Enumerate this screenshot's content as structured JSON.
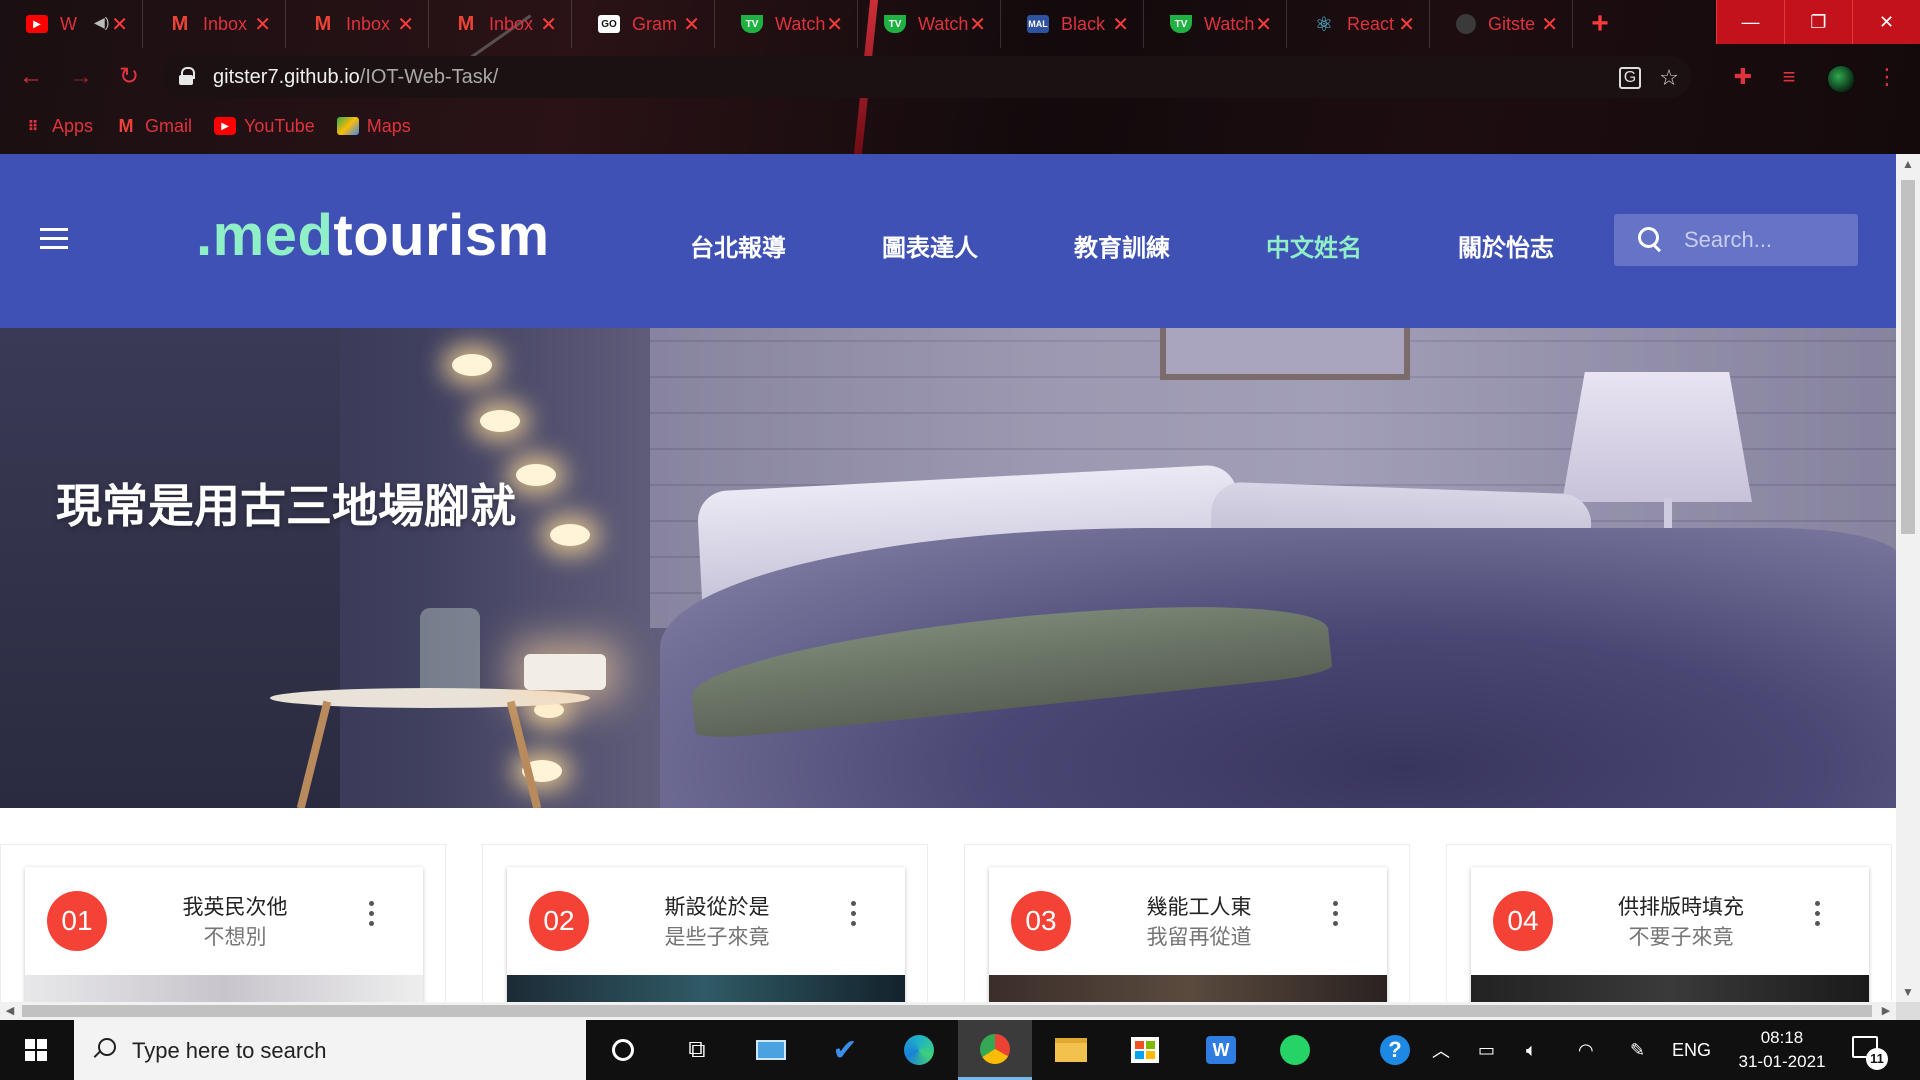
{
  "browser": {
    "tabs": [
      {
        "label": "W",
        "icon": "youtube-icon",
        "color": "#ff0000"
      },
      {
        "label": "Inbox",
        "icon": "gmail-icon",
        "color": "#ea4335"
      },
      {
        "label": "Inbox",
        "icon": "gmail-icon",
        "color": "#ea4335"
      },
      {
        "label": "Inbox",
        "icon": "gmail-icon",
        "color": "#ea4335"
      },
      {
        "label": "Gram",
        "icon": "grammarly-icon",
        "color": "#ffffff"
      },
      {
        "label": "Watch",
        "icon": "tv-icon",
        "color": "#1fb141"
      },
      {
        "label": "Watch",
        "icon": "tv-icon",
        "color": "#1fb141"
      },
      {
        "label": "Black",
        "icon": "mal-icon",
        "color": "#2e51a2"
      },
      {
        "label": "Watch",
        "icon": "tv-icon",
        "color": "#1fb141"
      },
      {
        "label": "React",
        "icon": "react-icon",
        "color": "#61dafb"
      },
      {
        "label": "Gitste",
        "icon": "github-icon",
        "color": "#3a3a3a"
      }
    ],
    "url_host": "gitster7.github.io",
    "url_path": "/IOT-Web-Task/",
    "bookmarks": [
      {
        "label": "Apps",
        "icon": "apps-grid-icon"
      },
      {
        "label": "Gmail",
        "icon": "gmail-icon"
      },
      {
        "label": "YouTube",
        "icon": "youtube-icon"
      },
      {
        "label": "Maps",
        "icon": "maps-icon"
      }
    ],
    "accent_color": "#e0323d"
  },
  "site": {
    "brand_accent": ".med",
    "brand_rest": "tourism",
    "nav": [
      {
        "label": "台北報導",
        "active": false
      },
      {
        "label": "圖表達人",
        "active": false
      },
      {
        "label": "教育訓練",
        "active": false
      },
      {
        "label": "中文姓名",
        "active": true
      },
      {
        "label": "關於怡志",
        "active": false
      }
    ],
    "search_placeholder": "Search...",
    "hero_title": "現常是用古三地場腳就",
    "primary_color": "#3f51b5",
    "active_color": "#8ff0c8",
    "cards": [
      {
        "number": "01",
        "title": "我英民次他",
        "subtitle": "不想別"
      },
      {
        "number": "02",
        "title": "斯設從於是",
        "subtitle": "是些子來竟"
      },
      {
        "number": "03",
        "title": "幾能工人東",
        "subtitle": "我留再從道"
      },
      {
        "number": "04",
        "title": "供排版時填充",
        "subtitle": "不要子來竟"
      }
    ]
  },
  "taskbar": {
    "search_placeholder": "Type here to search",
    "language": "ENG",
    "time": "08:18",
    "date": "31-01-2021",
    "notification_count": "11"
  }
}
